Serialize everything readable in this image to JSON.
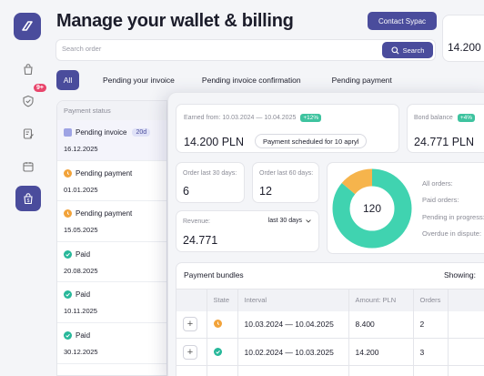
{
  "page": {
    "title": "Manage your wallet & billing",
    "contact_label": "Contact Sypac",
    "search": {
      "placeholder": "Search order",
      "button_label": "Search"
    },
    "top_right_card_value": "14.200 PLN"
  },
  "sidebar": {
    "badge_count": "9+",
    "items": [
      {
        "icon": "bag-icon"
      },
      {
        "icon": "shield-check-icon"
      },
      {
        "icon": "edit-document-icon"
      },
      {
        "icon": "calendar-icon"
      },
      {
        "icon": "wallet-icon",
        "active": true
      }
    ]
  },
  "tabs": [
    {
      "label": "All",
      "active": true
    },
    {
      "label": "Pending your invoice"
    },
    {
      "label": "Pending invoice confirmation"
    },
    {
      "label": "Pending payment"
    }
  ],
  "list": {
    "header": "Payment status",
    "items": [
      {
        "status": "Pending invoice",
        "tag": "20d",
        "date": "16.12.2025",
        "type": "invoice",
        "selected": true
      },
      {
        "status": "Pending payment",
        "date": "01.01.2025",
        "type": "pending"
      },
      {
        "status": "Pending payment",
        "date": "15.05.2025",
        "type": "pending"
      },
      {
        "status": "Paid",
        "date": "20.08.2025",
        "type": "paid"
      },
      {
        "status": "Paid",
        "date": "10.11.2025",
        "type": "paid"
      },
      {
        "status": "Paid",
        "date": "30.12.2025",
        "type": "paid"
      }
    ]
  },
  "earned": {
    "label": "Earned from: 10.03.2024 — 10.04.2025",
    "pct": "+12%",
    "value": "14.200 PLN",
    "scheduled": "Payment scheduled for 10 apryl"
  },
  "bond": {
    "label": "Bond balance",
    "pct": "+4%",
    "value": "24.771 PLN"
  },
  "orders30": {
    "label": "Order last 30 days:",
    "value": "6"
  },
  "orders60": {
    "label": "Order last 60 days:",
    "value": "12"
  },
  "revenue": {
    "label": "Revenue:",
    "period": "last 30 days",
    "value": "24.771"
  },
  "donut": {
    "center": "120",
    "segments": [
      {
        "label": "Paid orders",
        "fraction": 0.86,
        "color": "#40d3b0"
      },
      {
        "label": "Pending",
        "fraction": 0.14,
        "color": "#f6b44c"
      }
    ],
    "legend": [
      "All orders:",
      "Paid orders:",
      "Pending in progress:",
      "Overdue in dispute:"
    ]
  },
  "bundles": {
    "title": "Payment bundles",
    "showing": "Showing:",
    "columns": [
      "",
      "State",
      "Interval",
      "Amount: PLN",
      "Orders",
      ""
    ],
    "rows": [
      {
        "state": "pending",
        "interval": "10.03.2024 — 10.04.2025",
        "amount": "8.400",
        "orders": "2"
      },
      {
        "state": "paid",
        "interval": "10.02.2024 — 10.03.2025",
        "amount": "14.200",
        "orders": "3"
      }
    ]
  },
  "colors": {
    "accent": "#4a4c9c",
    "green": "#27b89a",
    "orange": "#f2a33a",
    "badge": "#e8456c"
  }
}
